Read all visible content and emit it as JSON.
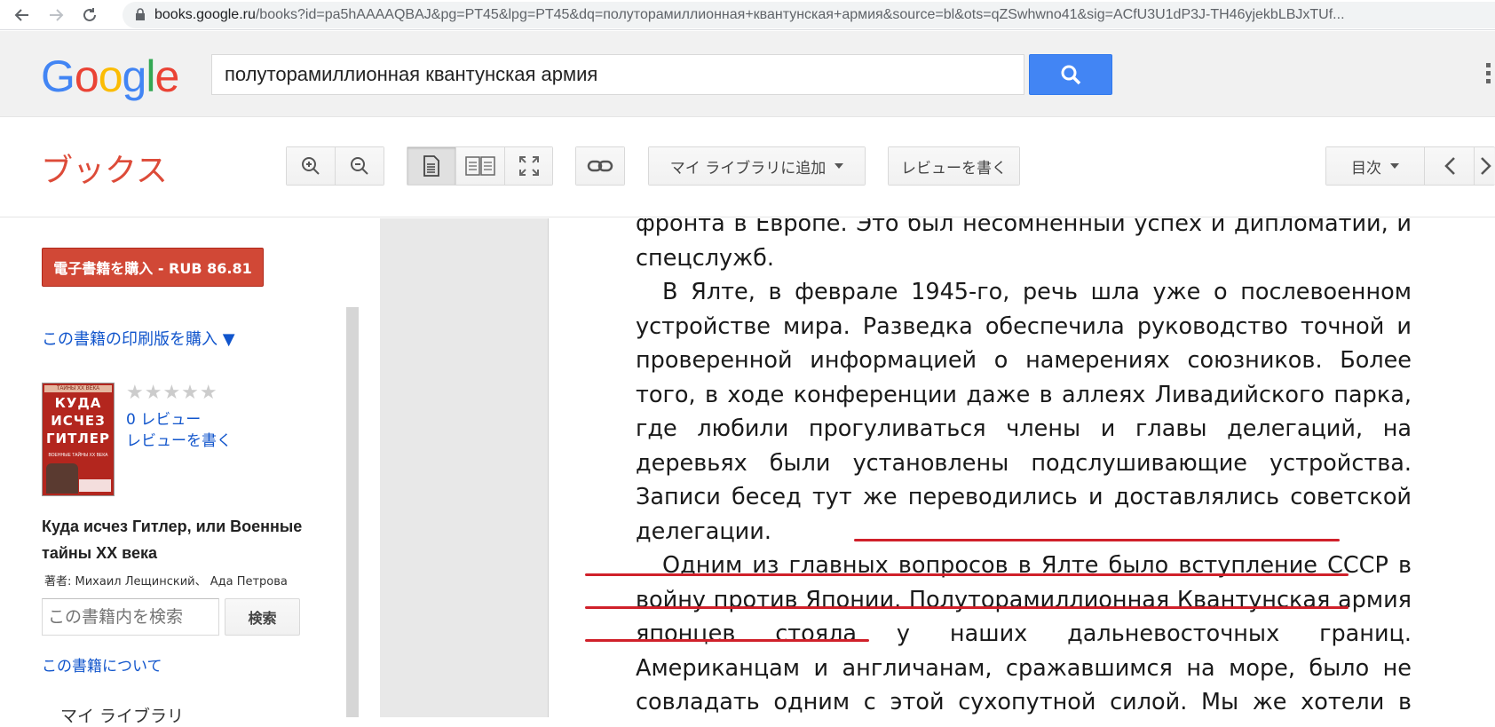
{
  "browser": {
    "url_host": "books.google.ru",
    "url_path": "/books?id=pa5hAAAAQBAJ&pg=PT45&lpg=PT45&dq=полуторамиллионная+квантунская+армия&source=bl&ots=qZSwhwno41&sig=ACfU3U1dP3J-TH46yjekbLBJxTUf..."
  },
  "header": {
    "logo_letters": [
      "G",
      "o",
      "o",
      "g",
      "l",
      "e"
    ],
    "logo_colors": [
      "#4285f4",
      "#ea4335",
      "#fbbc05",
      "#4285f4",
      "#34a853",
      "#ea4335"
    ],
    "search_value": "полуторамиллионная квантунская армия"
  },
  "toolbar": {
    "brand": "ブックス",
    "add_to_library": "マイ ライブラリに追加",
    "write_review": "レビューを書く",
    "toc": "目次"
  },
  "sidebar": {
    "buy_ebook": "電子書籍を購入 - RUB 86.81",
    "buy_print": "この書籍の印刷版を購入 ▼",
    "cover_top": "ТАЙНЫ ХХ ВЕКА",
    "cover_title_lines": [
      "КУДА",
      "ИСЧЕЗ",
      "ГИТЛЕР"
    ],
    "cover_subtitle": "ВОЕННЫЕ ТАЙНЫ ХХ ВЕКА",
    "stars": "★★★★★",
    "review_count": "0 レビュー",
    "write_review": "レビューを書く",
    "book_title": "Куда исчез Гитлер, или Военные тайны ХХ века",
    "authors": "著者: Михаил Лещинский、 Ада Петрова",
    "search_placeholder": "この書籍内を検索",
    "search_button": "検索",
    "about": "この書籍について",
    "my_library": "マイ ライブラリ"
  },
  "page": {
    "paragraphs": [
      {
        "indent": false,
        "text": "фронта в Европе. Это был несомненный успех и дипломатии, и спецслужб."
      },
      {
        "indent": true,
        "text": "В Ялте, в феврале 1945-го, речь шла уже о послевоенном устройстве мира. Разведка обеспечила руководство точной и проверенной информацией о намерениях союзников. Более того, в ходе конференции даже в аллеях Ливадийского парка, где любили прогуливаться члены и главы делегаций, на деревьях были установлены подслушивающие устройства. Записи бесед тут же переводились и доставлялись советской делегации."
      },
      {
        "indent": true,
        "text": "Одним из главных вопросов в Ялте было вступление СССР в войну против Японии. Полуторамиллионная Квантунская армия японцев стояла у наших дальневосточных границ. Американцам и англичанам, сражавшимся на море, было не совладать одним с этой сухопутной силой. Мы же хотели в обмен материальной"
      }
    ],
    "underline_color": "#d0202a"
  }
}
